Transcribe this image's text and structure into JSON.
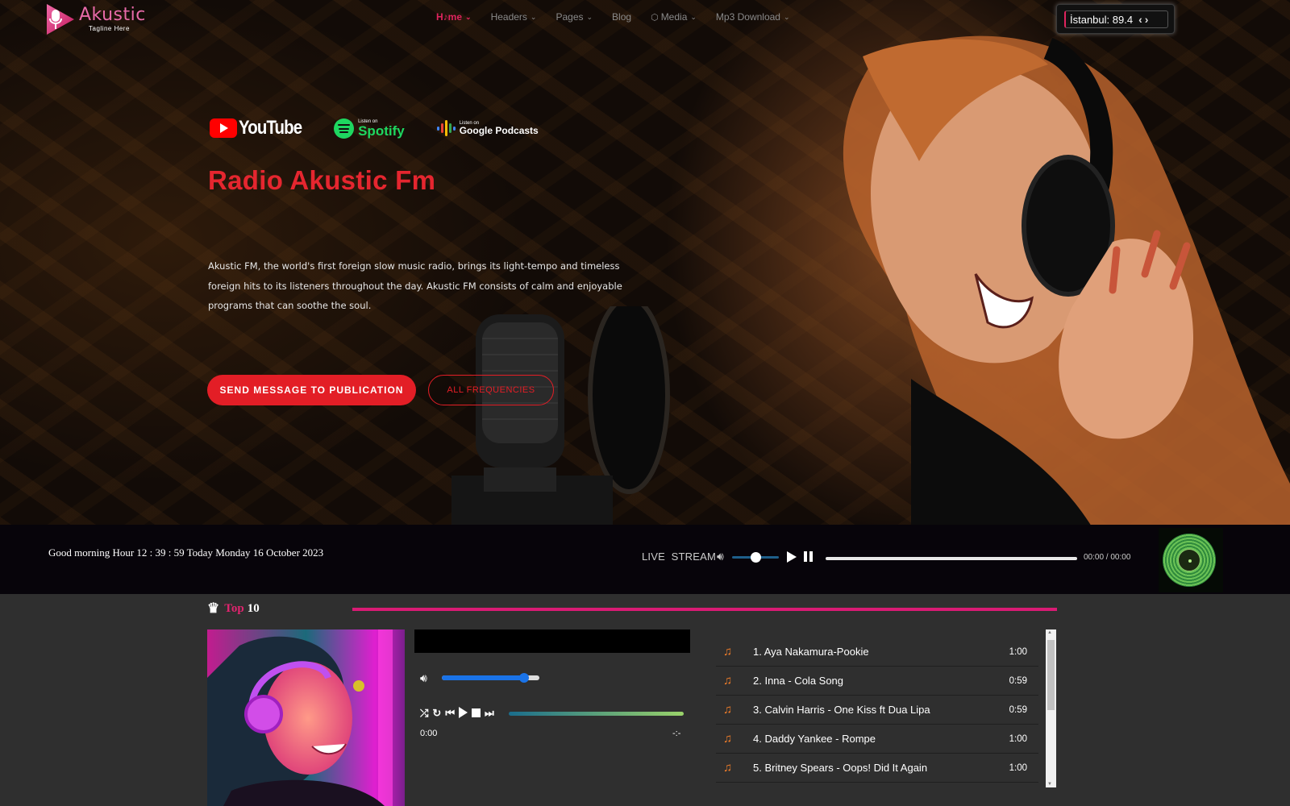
{
  "brand": {
    "name": "Akustic",
    "tagline": "Tagline Here",
    "accent": "#e0245e",
    "red": "#e31e26"
  },
  "nav": {
    "items": [
      {
        "label": "H♪me",
        "active": true,
        "dropdown": true
      },
      {
        "label": "Headers",
        "dropdown": true
      },
      {
        "label": "Pages",
        "dropdown": true
      },
      {
        "label": "Blog",
        "dropdown": false
      },
      {
        "label": "Media",
        "dropdown": true,
        "icon": "cube-icon"
      },
      {
        "label": "Mp3 Download",
        "dropdown": true
      }
    ],
    "frequency": {
      "text": "İstanbul: 89.4",
      "prev_icon": "‹",
      "next_icon": "›"
    }
  },
  "hero": {
    "platforms": {
      "youtube": "YouTube",
      "spotify_small": "Listen on",
      "spotify": "Spotify",
      "google_small": "Listen on",
      "google": "Google Podcasts"
    },
    "title": "Radio Akustic Fm",
    "description": "Akustic FM, the world's first foreign slow music radio, brings its light-tempo and timeless foreign hits to its listeners throughout the day. Akustic FM consists of calm and enjoyable programs that can soothe the soul.",
    "primary_button": "SEND MESSAGE TO PUBLICATION",
    "secondary_button": "ALL FREQUENCIES"
  },
  "player_bar": {
    "greeting": "Good morning Hour 12 : 39 : 59 Today Monday 16 October 2023",
    "live_label": "LIVE  STREAM",
    "volume_percent": 50,
    "time": "00:00 / 00:00",
    "progress_percent": 100
  },
  "top10": {
    "word_top": "Top",
    "word_num": "10",
    "volume_percent": 88,
    "progress_percent": 0,
    "time_start": "0:00",
    "time_end": "-:-",
    "tracks": [
      {
        "title": "1. Aya Nakamura-Pookie",
        "duration": "1:00"
      },
      {
        "title": "2. Inna - Cola Song",
        "duration": "0:59"
      },
      {
        "title": "3. Calvin Harris - One Kiss ft Dua Lipa",
        "duration": "0:59"
      },
      {
        "title": "4. Daddy Yankee - Rompe",
        "duration": "1:00"
      },
      {
        "title": "5. Britney Spears - Oops! Did It Again",
        "duration": "1:00"
      }
    ]
  }
}
